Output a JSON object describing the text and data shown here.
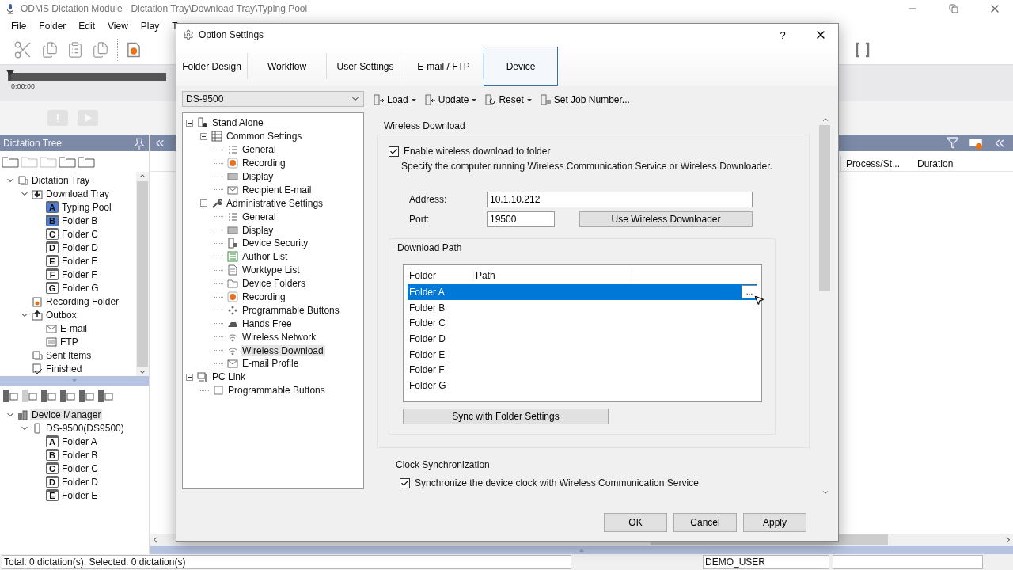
{
  "app": {
    "title": "ODMS Dictation Module - Dictation Tray\\Download Tray\\Typing Pool"
  },
  "menu": [
    "File",
    "Folder",
    "Edit",
    "View",
    "Play",
    "T"
  ],
  "timeline": {
    "time": "0:00:00"
  },
  "dictation_tree": {
    "title": "Dictation Tree",
    "items": [
      {
        "label": "Dictation Tray",
        "kind": "tray",
        "expanded": true,
        "children": [
          {
            "label": "Download Tray",
            "kind": "download",
            "expanded": true,
            "children": [
              {
                "label": "Typing Pool",
                "kind": "letter",
                "letter": "A",
                "filled": true
              },
              {
                "label": "Folder B",
                "kind": "letter",
                "letter": "B",
                "filled": true
              },
              {
                "label": "Folder C",
                "kind": "letter",
                "letter": "C",
                "filled": false
              },
              {
                "label": "Folder D",
                "kind": "letter",
                "letter": "D",
                "filled": false
              },
              {
                "label": "Folder E",
                "kind": "letter",
                "letter": "E",
                "filled": false
              },
              {
                "label": "Folder F",
                "kind": "letter",
                "letter": "F",
                "filled": false
              },
              {
                "label": "Folder G",
                "kind": "letter",
                "letter": "G",
                "filled": false
              }
            ]
          },
          {
            "label": "Recording Folder",
            "kind": "recording"
          },
          {
            "label": "Outbox",
            "kind": "outbox",
            "expanded": true,
            "children": [
              {
                "label": "E-mail",
                "kind": "mail"
              },
              {
                "label": "FTP",
                "kind": "ftp"
              }
            ]
          },
          {
            "label": "Sent Items",
            "kind": "tray"
          },
          {
            "label": "Finished",
            "kind": "finished"
          }
        ]
      }
    ]
  },
  "device_tree": {
    "items": [
      {
        "label": "Device Manager",
        "kind": "devices",
        "selected": true,
        "expanded": true,
        "children": [
          {
            "label": "DS-9500(DS9500)",
            "kind": "recorder",
            "selected": false,
            "expanded": true,
            "children": [
              {
                "label": "Folder A",
                "kind": "letter",
                "letter": "A",
                "filled": false,
                "selected": false
              },
              {
                "label": "Folder B",
                "kind": "letter",
                "letter": "B",
                "filled": false,
                "selected": false
              },
              {
                "label": "Folder C",
                "kind": "letter",
                "letter": "C",
                "filled": false,
                "selected": false
              },
              {
                "label": "Folder D",
                "kind": "letter",
                "letter": "D",
                "filled": false,
                "selected": false
              },
              {
                "label": "Folder E",
                "kind": "letter",
                "letter": "E",
                "filled": false,
                "selected": false
              }
            ]
          }
        ]
      }
    ]
  },
  "list": {
    "columns": [
      "Process/St...",
      "Duration"
    ]
  },
  "status_bar": {
    "summary": "Total: 0 dictation(s), Selected: 0 dictation(s)",
    "user": "DEMO_USER"
  },
  "dialog": {
    "title": "Option Settings",
    "help": "?",
    "tabs": [
      {
        "label": "Folder Design",
        "selected": false
      },
      {
        "label": "Workflow",
        "selected": false
      },
      {
        "label": "User Settings",
        "selected": false
      },
      {
        "label": "E-mail / FTP",
        "selected": false
      },
      {
        "label": "Device",
        "selected": true
      }
    ],
    "device_select": "DS-9500",
    "toolbar": [
      {
        "label": "Load",
        "kind": "load",
        "dropdown": true
      },
      {
        "label": "Update",
        "kind": "update",
        "dropdown": true
      },
      {
        "label": "Reset",
        "kind": "reset",
        "dropdown": true
      },
      {
        "label": "Set Job Number...",
        "kind": "job",
        "dropdown": false
      }
    ],
    "tree": [
      {
        "label": "Stand Alone",
        "kind": "device",
        "selected": false,
        "expanded": true,
        "children": [
          {
            "label": "Common Settings",
            "kind": "table",
            "selected": false,
            "expanded": true,
            "children": [
              {
                "label": "General",
                "kind": "list",
                "selected": false
              },
              {
                "label": "Recording",
                "kind": "record",
                "selected": false
              },
              {
                "label": "Display",
                "kind": "display",
                "selected": false
              },
              {
                "label": "Recipient E-mail",
                "kind": "mail",
                "selected": false
              }
            ]
          },
          {
            "label": "Administrative Settings",
            "kind": "wrench",
            "selected": false,
            "expanded": true,
            "children": [
              {
                "label": "General",
                "kind": "list",
                "selected": false
              },
              {
                "label": "Display",
                "kind": "display",
                "selected": false
              },
              {
                "label": "Device Security",
                "kind": "security",
                "selected": false
              },
              {
                "label": "Author List",
                "kind": "author",
                "selected": false
              },
              {
                "label": "Worktype List",
                "kind": "doc",
                "selected": false
              },
              {
                "label": "Device Folders",
                "kind": "folder",
                "selected": false
              },
              {
                "label": "Recording",
                "kind": "record",
                "selected": false
              },
              {
                "label": "Programmable Buttons",
                "kind": "buttons",
                "selected": false
              },
              {
                "label": "Hands Free",
                "kind": "pedal",
                "selected": false
              },
              {
                "label": "Wireless Network",
                "kind": "wifi",
                "selected": false
              },
              {
                "label": "Wireless Download",
                "kind": "wifi",
                "selected": true
              },
              {
                "label": "E-mail Profile",
                "kind": "mail",
                "selected": false
              }
            ]
          }
        ]
      },
      {
        "label": "PC Link",
        "kind": "pc",
        "selected": false,
        "expanded": true,
        "children": [
          {
            "label": "Programmable Buttons",
            "kind": "square",
            "selected": false
          }
        ]
      }
    ],
    "wireless": {
      "title": "Wireless Download",
      "enable": {
        "label": "Enable wireless download to folder",
        "checked": true
      },
      "description": "Specify the computer running Wireless Communication Service or Wireless Downloader.",
      "address_label": "Address:",
      "address": "10.1.10.212",
      "port_label": "Port:",
      "port": "19500",
      "downloader_button": "Use Wireless Downloader"
    },
    "download_path": {
      "title": "Download Path",
      "columns": [
        "Folder",
        "Path"
      ],
      "browse_button": "...",
      "rows": [
        {
          "folder": "Folder A",
          "selected": true
        },
        {
          "folder": "Folder B",
          "selected": false
        },
        {
          "folder": "Folder C",
          "selected": false
        },
        {
          "folder": "Folder D",
          "selected": false
        },
        {
          "folder": "Folder E",
          "selected": false
        },
        {
          "folder": "Folder F",
          "selected": false
        },
        {
          "folder": "Folder G",
          "selected": false
        }
      ],
      "sync_button": "Sync with Folder Settings"
    },
    "clock": {
      "title": "Clock Synchronization",
      "sync": {
        "label": "Synchronize the device clock with Wireless Communication Service",
        "checked": true
      }
    },
    "buttons": [
      "OK",
      "Cancel",
      "Apply"
    ]
  }
}
